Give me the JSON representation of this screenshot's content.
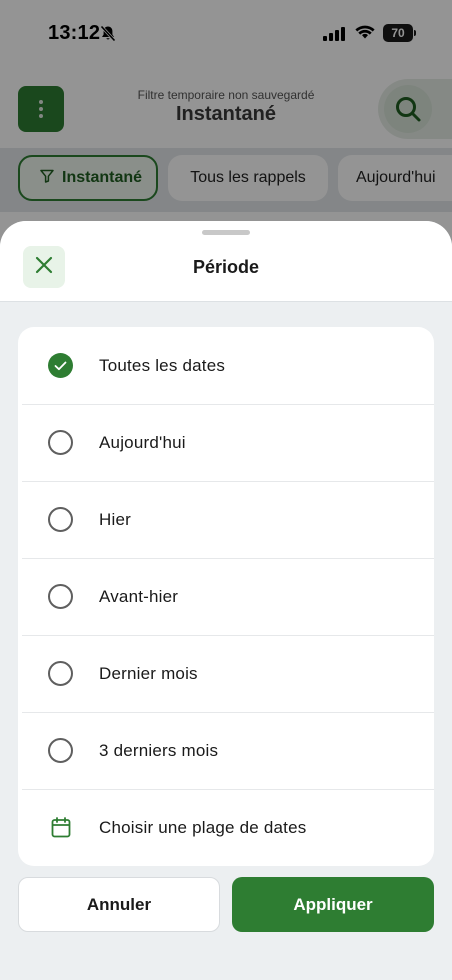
{
  "status_bar": {
    "time": "13:12",
    "battery": "70",
    "icons": [
      "bell-slash-icon",
      "signal-icon",
      "wifi-icon",
      "battery-icon"
    ]
  },
  "header": {
    "subtitle": "Filtre temporaire non sauvegardé",
    "title": "Instantané",
    "menu_icon": "more-vertical-icon",
    "search_icon": "search-icon"
  },
  "filter_chips": [
    {
      "label": "Instantané",
      "icon": "filter-icon",
      "active": true
    },
    {
      "label": "Tous les rappels",
      "active": false
    },
    {
      "label": "Aujourd'hui",
      "active": false
    }
  ],
  "sheet": {
    "title": "Période",
    "close_icon": "close-icon",
    "options": [
      {
        "label": "Toutes les dates",
        "selected": true
      },
      {
        "label": "Aujourd'hui",
        "selected": false
      },
      {
        "label": "Hier",
        "selected": false
      },
      {
        "label": "Avant-hier",
        "selected": false
      },
      {
        "label": "Dernier mois",
        "selected": false
      },
      {
        "label": "3 derniers mois",
        "selected": false
      },
      {
        "label": "Choisir une plage de dates",
        "icon": "calendar-icon"
      }
    ],
    "cancel_label": "Annuler",
    "apply_label": "Appliquer"
  },
  "colors": {
    "accent": "#2e7d32",
    "accent_light": "#e8f3e8",
    "sheet_background": "#eceff1"
  }
}
